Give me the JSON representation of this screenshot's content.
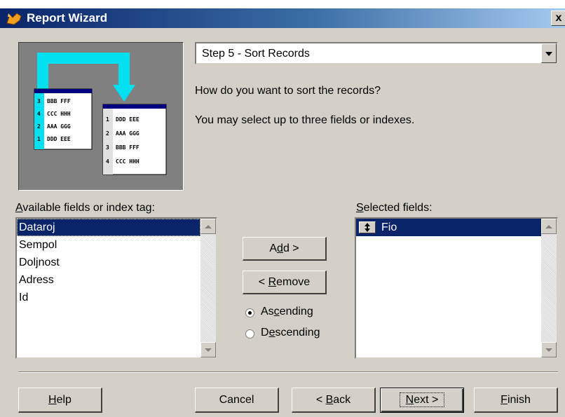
{
  "window": {
    "title": "Report Wizard",
    "close_label": "x",
    "colors": {
      "titlebar_start": "#0a246a",
      "titlebar_end": "#a6caf0",
      "face": "#d4d0c8",
      "selection": "#0a246a"
    }
  },
  "step": {
    "selected": "Step 5 - Sort Records"
  },
  "instructions": {
    "line1": "How do you want to sort the records?",
    "line2": "You may select up to three fields or indexes."
  },
  "illustration": {
    "left_table": [
      {
        "n": "3",
        "text": "BBB FFF"
      },
      {
        "n": "4",
        "text": "CCC HHH"
      },
      {
        "n": "2",
        "text": "AAA GGG"
      },
      {
        "n": "1",
        "text": "DDD EEE"
      }
    ],
    "right_table": [
      {
        "n": "1",
        "text": "DDD EEE"
      },
      {
        "n": "2",
        "text": "AAA GGG"
      },
      {
        "n": "3",
        "text": "BBB FFF"
      },
      {
        "n": "4",
        "text": "CCC HHH"
      }
    ]
  },
  "available": {
    "label_u": "A",
    "label_rest": "vailable fields or index tag:",
    "items": [
      "Dataroj",
      "Sempol",
      "Doljnost",
      "Adress",
      "Id"
    ],
    "selected_index": 0
  },
  "selected_fields": {
    "label_u": "S",
    "label_rest": "elected fields:",
    "items": [
      "Fio"
    ]
  },
  "buttons": {
    "add_pre": "A",
    "add_u": "d",
    "add_post": "d >",
    "remove_pre": "< ",
    "remove_u": "R",
    "remove_post": "emove",
    "help_u": "H",
    "help_post": "elp",
    "cancel": "Cancel",
    "back_pre": "< ",
    "back_u": "B",
    "back_post": "ack",
    "next_u": "N",
    "next_post": "ext >",
    "finish_u": "F",
    "finish_post": "inish"
  },
  "sort_order": {
    "ascending_pre": "As",
    "ascending_u": "c",
    "ascending_post": "ending",
    "descending_pre": "D",
    "descending_u": "e",
    "descending_post": "scending",
    "selected": "ascending"
  }
}
